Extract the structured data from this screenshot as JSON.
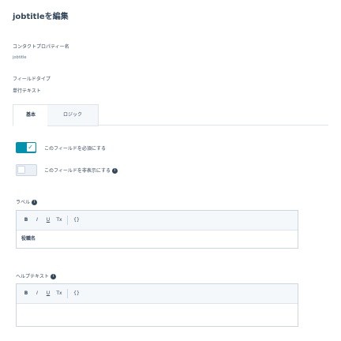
{
  "page": {
    "title": "jobtitleを編集"
  },
  "contact_property": {
    "label": "コンタクトプロパティー名",
    "value": "jobtitle"
  },
  "field_type": {
    "label": "フィールドタイプ",
    "value": "単行テキスト"
  },
  "tabs": [
    {
      "label": "基本"
    },
    {
      "label": "ロジック"
    }
  ],
  "toggles": [
    {
      "label": "このフィールドを必須にする",
      "state": "on"
    },
    {
      "label": "このフィールドを非表示にする",
      "state": "off"
    }
  ],
  "label_field": {
    "label": "ラベル",
    "toolbar": [
      "B",
      "I",
      "U",
      "Tx",
      "{}"
    ],
    "content": "役職名"
  },
  "help_text_field": {
    "label": "ヘルプテキスト",
    "toolbar": [
      "B",
      "I",
      "U",
      "Tx",
      "{}"
    ],
    "content": ""
  },
  "icons": {
    "info": "info-icon",
    "check": "check-icon"
  },
  "colors": {
    "accent": "#0091ae",
    "text": "#33475b",
    "border": "#cbd6e2"
  }
}
